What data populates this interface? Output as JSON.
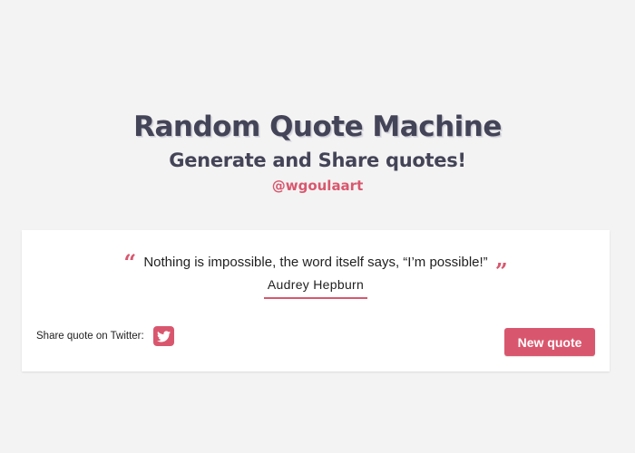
{
  "header": {
    "title": "Random Quote Machine",
    "subtitle": "Generate and Share quotes!",
    "handle": "@wgoulaart"
  },
  "quote": {
    "text": "Nothing is impossible, the word itself says, “I’m possible!”",
    "open_mark": "“",
    "close_mark": "”",
    "author": "Audrey Hepburn"
  },
  "share": {
    "label": "Share quote on Twitter:",
    "icon": "twitter-icon"
  },
  "actions": {
    "new_quote_label": "New quote"
  },
  "colors": {
    "accent": "#d9576e",
    "title": "#444458",
    "background": "#f3f3f3",
    "card": "#ffffff"
  }
}
